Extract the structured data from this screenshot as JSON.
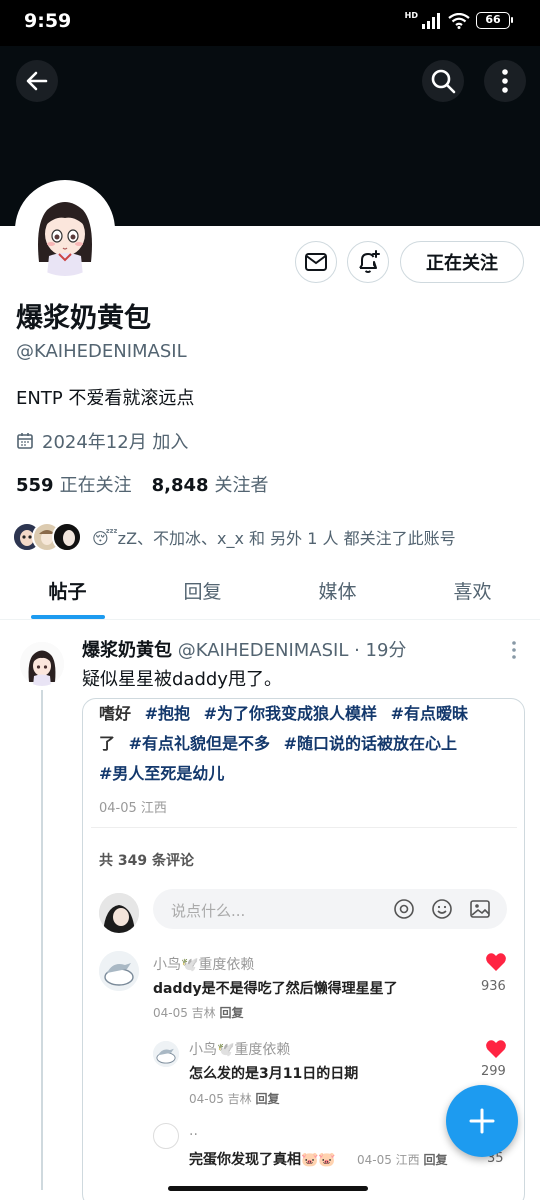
{
  "status_bar": {
    "time": "9:59",
    "network": "HD",
    "battery": "66"
  },
  "profile": {
    "name": "爆浆奶黄包",
    "handle": "@KAIHEDENIMASIL",
    "bio": "ENTP 不爱看就滚远点",
    "joined": "2024年12月 加入",
    "following_count": "559",
    "following_label": "正在关注",
    "followers_count": "8,848",
    "followers_label": "关注者",
    "follow_button": "正在关注",
    "followed_by_text": "😴zZ、不加冰、x_x 和 另外 1 人 都关注了此账号"
  },
  "tabs": [
    {
      "label": "帖子",
      "active": true
    },
    {
      "label": "回复",
      "active": false
    },
    {
      "label": "媒体",
      "active": false
    },
    {
      "label": "喜欢",
      "active": false
    }
  ],
  "post": {
    "author": "爆浆奶黄包",
    "meta": "@KAIHEDENIMASIL · 19分",
    "text": "疑似星星被daddy甩了。",
    "card": {
      "tags_line1_plain": "嗜好",
      "tags_line1": [
        "#抱抱",
        "#为了你我变成狼人模样",
        "#有点暧昧"
      ],
      "tags_line2_plain": "了",
      "tags_line2": [
        "#有点礼貌但是不多",
        "#随口说的话被放在心上"
      ],
      "tags_line3": [
        "#男人至死是幼儿"
      ],
      "date": "04-05 江西",
      "comment_count": "共 349 条评论",
      "input_placeholder": "说点什么...",
      "comments": [
        {
          "user": "小鸟🕊️重度依赖",
          "text": "daddy是不是得吃了然后懒得理星星了",
          "meta": "04-05 吉林",
          "reply": "回复",
          "likes": "936"
        },
        {
          "user": "小鸟🕊️重度依赖",
          "text": "怎么发的是3月11日的日期",
          "meta": "04-05 吉林",
          "reply": "回复",
          "likes": "299"
        },
        {
          "user": "..",
          "text": "完蛋你发现了真相🐷🐷",
          "meta": "04-05 江西",
          "reply": "回复",
          "likes": "35"
        }
      ]
    }
  },
  "colors": {
    "accent": "#1d9bf0",
    "heart": "#ff2442",
    "tag": "#13386c"
  },
  "icons": [
    "back-arrow-icon",
    "search-icon",
    "more-vertical-icon",
    "mail-icon",
    "bell-plus-icon",
    "calendar-icon",
    "at-icon",
    "emoji-icon",
    "image-icon",
    "heart-icon",
    "plus-icon"
  ]
}
